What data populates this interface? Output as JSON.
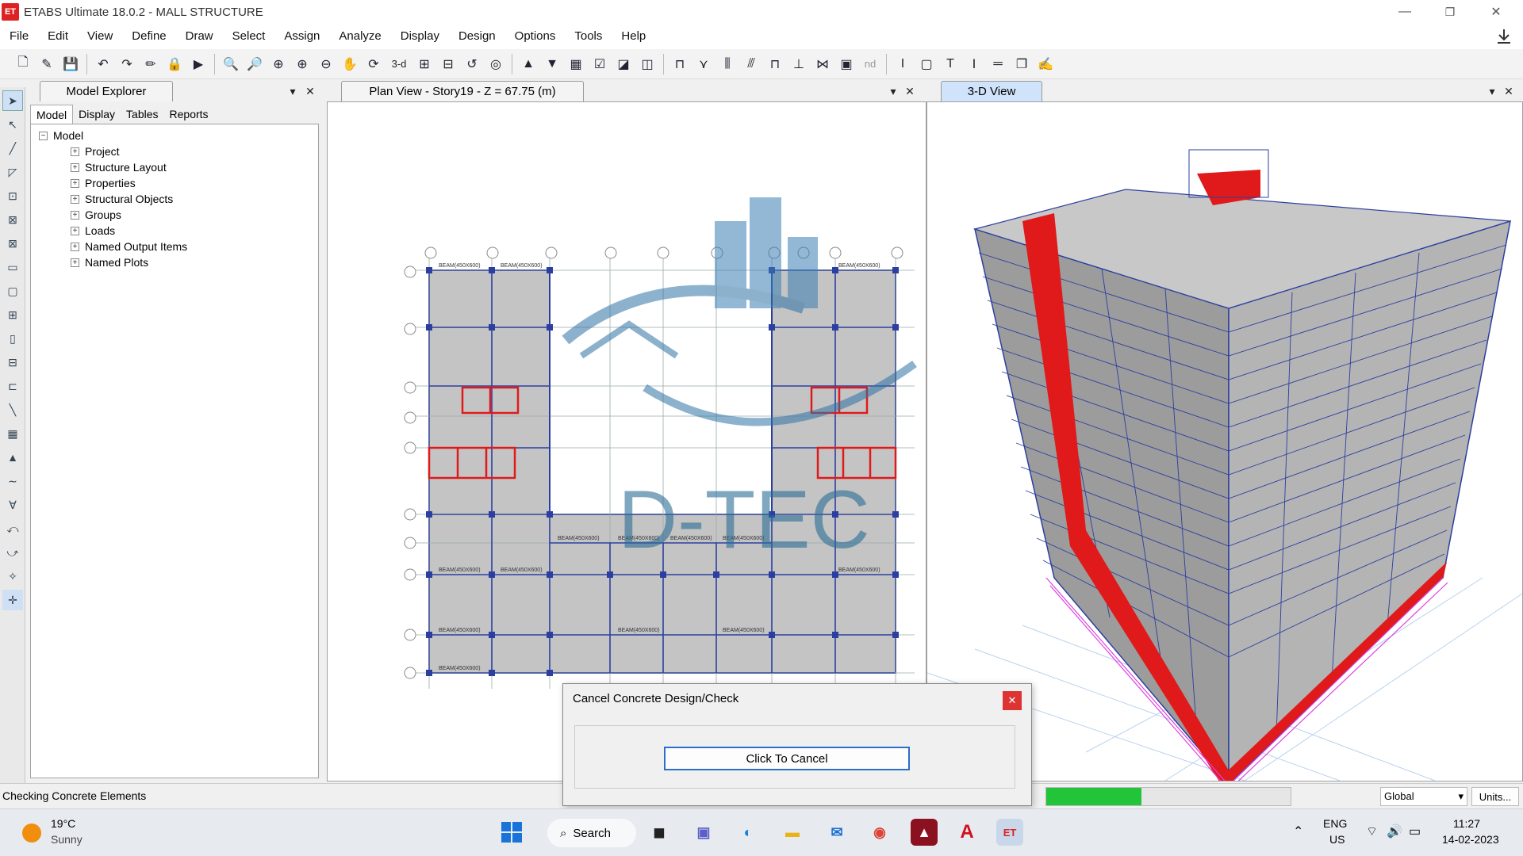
{
  "app": {
    "icon_text": "ET",
    "title": "ETABS Ultimate 18.0.2 - MALL STRUCTURE",
    "minimize": "—",
    "maximize": "❐",
    "close": "✕"
  },
  "menu": [
    "File",
    "Edit",
    "View",
    "Define",
    "Draw",
    "Select",
    "Assign",
    "Analyze",
    "Display",
    "Design",
    "Options",
    "Tools",
    "Help"
  ],
  "toolbar": {
    "tool_3d": "3-d",
    "tool_nd": "nd"
  },
  "explorer": {
    "tab_title": "Model Explorer",
    "subtabs": [
      "Model",
      "Display",
      "Tables",
      "Reports"
    ],
    "root": "Model",
    "nodes": [
      "Project",
      "Structure Layout",
      "Properties",
      "Structural Objects",
      "Groups",
      "Loads",
      "Named Output Items",
      "Named Plots"
    ]
  },
  "plan_view": {
    "tab_title": "Plan View - Story19 - Z = 67.75 (m)",
    "beam_label": "BEAM(450X600)",
    "watermark": "D-TEC"
  },
  "view3d": {
    "tab_title": "3-D View"
  },
  "status": {
    "text": "Checking Concrete Elements",
    "progress": 0.39,
    "coord_system": "Global",
    "units_button": "Units..."
  },
  "dialog": {
    "title": "Cancel Concrete Design/Check",
    "close": "✕",
    "button": "Click To Cancel"
  },
  "taskbar": {
    "weather_temp": "19°C",
    "weather_desc": "Sunny",
    "search": "Search",
    "lang": "ENG",
    "region": "US",
    "time": "11:27",
    "date": "14-02-2023"
  },
  "colors": {
    "accent": "#2b6fc9",
    "shear_wall": "#e01a1a",
    "slab": "#a8a8a8",
    "beam": "#2c3fa0",
    "progress": "#22c43a"
  }
}
